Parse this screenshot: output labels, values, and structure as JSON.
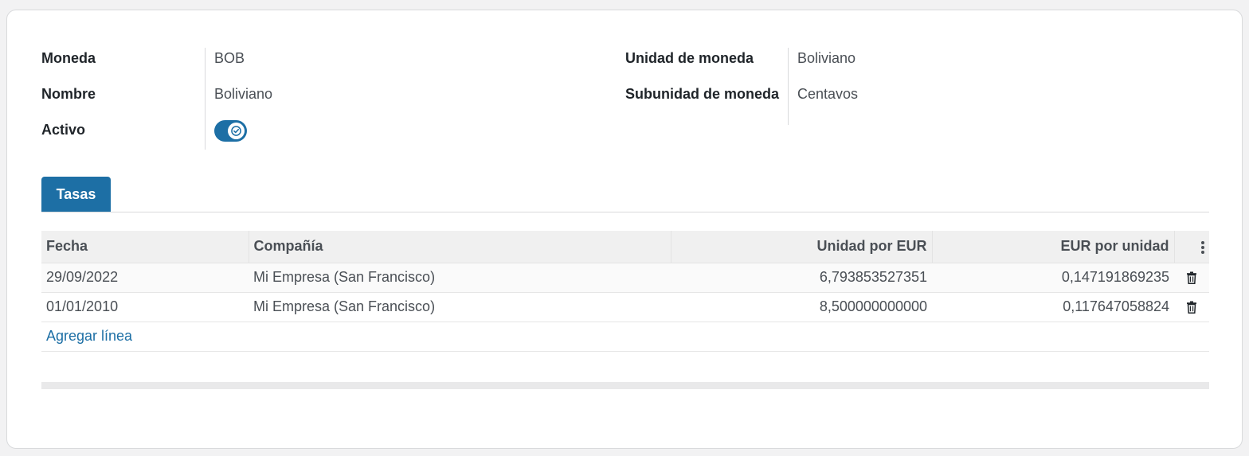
{
  "fields_left": {
    "currency_label": "Moneda",
    "currency_value": "BOB",
    "name_label": "Nombre",
    "name_value": "Boliviano",
    "active_label": "Activo",
    "active_value": true
  },
  "fields_right": {
    "unit_label": "Unidad de moneda",
    "unit_value": "Boliviano",
    "subunit_label": "Subunidad de moneda",
    "subunit_value": "Centavos"
  },
  "tabs": [
    {
      "label": "Tasas",
      "active": true
    }
  ],
  "rates_table": {
    "columns": [
      "Fecha",
      "Compañía",
      "Unidad por EUR",
      "EUR por unidad"
    ],
    "rows": [
      {
        "date": "29/09/2022",
        "company": "Mi Empresa (San Francisco)",
        "unit_per_eur": "6,793853527351",
        "eur_per_unit": "0,147191869235"
      },
      {
        "date": "01/01/2010",
        "company": "Mi Empresa (San Francisco)",
        "unit_per_eur": "8,500000000000",
        "eur_per_unit": "0,117647058824"
      }
    ],
    "add_line_label": "Agregar línea"
  },
  "colors": {
    "accent": "#1d6fa5",
    "label_text": "#1f2429",
    "body_text": "#4a4f55"
  },
  "icons": {
    "toggle": "check-icon",
    "row_action": "trash-icon",
    "header_options": "kebab-icon"
  }
}
